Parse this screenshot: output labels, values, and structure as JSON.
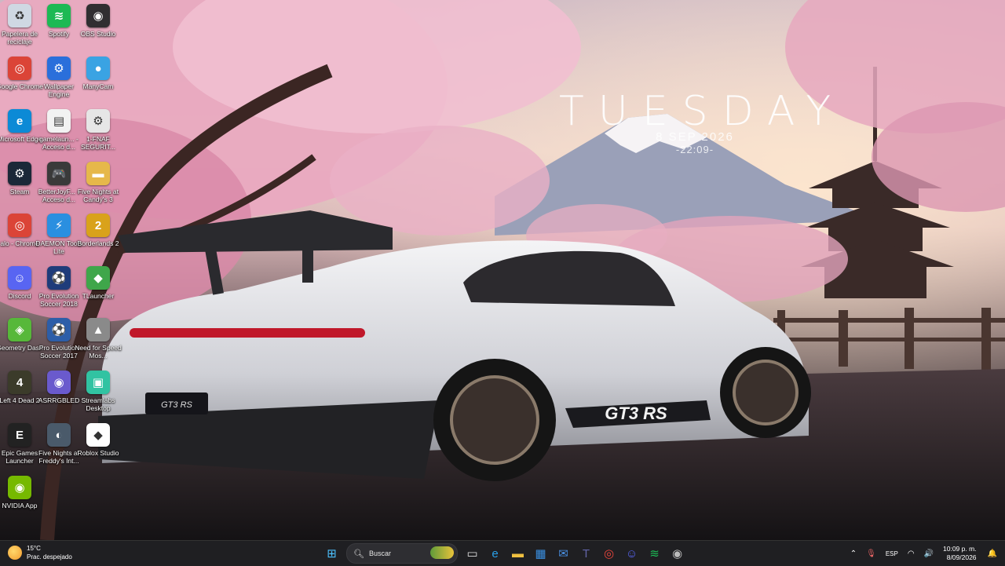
{
  "clock": {
    "day": "TUESDAY",
    "date": "8 SEP 2026",
    "time": "-22:09-"
  },
  "desktop_icons": [
    {
      "label": "Papelera de reciclaje",
      "icon": "recycle-bin-icon",
      "color": "#cfd8e3",
      "glyph": "♻"
    },
    {
      "label": "Spotify",
      "icon": "spotify-icon",
      "color": "#1db954",
      "glyph": "≋"
    },
    {
      "label": "OBS Studio",
      "icon": "obs-icon",
      "color": "#302e31",
      "glyph": "◉"
    },
    {
      "label": "Google Chrome",
      "icon": "chrome-icon",
      "color": "#db4437",
      "glyph": "◎"
    },
    {
      "label": "Wallpaper Engine",
      "icon": "wallpaper-engine-icon",
      "color": "#2a6fdb",
      "glyph": "⚙"
    },
    {
      "label": "ManyCam",
      "icon": "manycam-icon",
      "color": "#3aa3e3",
      "glyph": "●"
    },
    {
      "label": "Microsoft Edge",
      "icon": "edge-icon",
      "color": "#0c8ad6",
      "glyph": "e"
    },
    {
      "label": "gamelaun... - Acceso d...",
      "icon": "shortcut-icon",
      "color": "#f2f2f2",
      "glyph": "▤"
    },
    {
      "label": "1-FNAF SEGURIT...",
      "icon": "settings-file-icon",
      "color": "#e6e6e6",
      "glyph": "⚙"
    },
    {
      "label": "Steam",
      "icon": "steam-icon",
      "color": "#1b2838",
      "glyph": "⚙"
    },
    {
      "label": "BetterJoyF... - Acceso d...",
      "icon": "gamepad-icon",
      "color": "#3a3a3a",
      "glyph": "🎮"
    },
    {
      "label": "Five Nights at Candy's 3",
      "icon": "folder-icon",
      "color": "#e6b84a",
      "glyph": "▬"
    },
    {
      "label": "alo - Chrome",
      "icon": "chrome-icon",
      "color": "#db4437",
      "glyph": "◎"
    },
    {
      "label": "DAEMON Tools Lite",
      "icon": "daemon-tools-icon",
      "color": "#2a8fe0",
      "glyph": "⚡"
    },
    {
      "label": "Borderlands 2",
      "icon": "borderlands-icon",
      "color": "#d9a21b",
      "glyph": "2"
    },
    {
      "label": "Discord",
      "icon": "discord-icon",
      "color": "#5865f2",
      "glyph": "☺"
    },
    {
      "label": "Pro Evolution Soccer 2018",
      "icon": "pes-icon",
      "color": "#1f3c7a",
      "glyph": "⚽"
    },
    {
      "label": "TLauncher",
      "icon": "tlauncher-icon",
      "color": "#3fa64a",
      "glyph": "◆"
    },
    {
      "label": "Geometry Dash",
      "icon": "geometry-dash-icon",
      "color": "#57b83a",
      "glyph": "◈"
    },
    {
      "label": "Pro Evolution Soccer 2017",
      "icon": "pes-icon",
      "color": "#2d5ea8",
      "glyph": "⚽"
    },
    {
      "label": "Need for Speed Mos...",
      "icon": "nfs-icon",
      "color": "#8a8a8a",
      "glyph": "▲"
    },
    {
      "label": "Left 4 Dead 2",
      "icon": "l4d2-icon",
      "color": "#3b3b2a",
      "glyph": "4"
    },
    {
      "label": "ASRRGBLED",
      "icon": "asrrgb-icon",
      "color": "#6a5acd",
      "glyph": "◉"
    },
    {
      "label": "Streamlabs Desktop",
      "icon": "streamlabs-icon",
      "color": "#31c3a2",
      "glyph": "▣"
    },
    {
      "label": "Epic Games Launcher",
      "icon": "epic-games-icon",
      "color": "#222222",
      "glyph": "E"
    },
    {
      "label": "Five Nights at Freddy's Int...",
      "icon": "fnaf-icon",
      "color": "#4a5a6a",
      "glyph": "◐"
    },
    {
      "label": "Roblox Studio",
      "icon": "roblox-studio-icon",
      "color": "#ffffff",
      "glyph": "◆"
    },
    {
      "label": "NVIDIA App",
      "icon": "nvidia-icon",
      "color": "#76b900",
      "glyph": "◉"
    }
  ],
  "taskbar": {
    "weather_temp": "15°C",
    "weather_desc": "Prac. despejado",
    "search_placeholder": "Buscar",
    "apps": [
      {
        "icon": "windows-start-icon",
        "glyph": "⊞",
        "color": "#4cc2ff"
      },
      {
        "icon": "task-view-icon",
        "glyph": "▭",
        "color": "#dddddd"
      },
      {
        "icon": "edge-icon",
        "glyph": "e",
        "color": "#2aa0e8"
      },
      {
        "icon": "file-explorer-icon",
        "glyph": "▬",
        "color": "#f0c040"
      },
      {
        "icon": "store-icon",
        "glyph": "▦",
        "color": "#3a8fe0"
      },
      {
        "icon": "mail-icon",
        "glyph": "✉",
        "color": "#4a90e2"
      },
      {
        "icon": "teams-icon",
        "glyph": "T",
        "color": "#6264a7"
      },
      {
        "icon": "chrome-icon",
        "glyph": "◎",
        "color": "#e8453c"
      },
      {
        "icon": "discord-icon",
        "glyph": "☺",
        "color": "#5865f2"
      },
      {
        "icon": "spotify-icon",
        "glyph": "≋",
        "color": "#1db954"
      },
      {
        "icon": "obs-icon",
        "glyph": "◉",
        "color": "#bbbbbb"
      }
    ],
    "tray_lang": "ESP",
    "clock_time": "10:09 p. m.",
    "clock_date": "8/09/2026"
  }
}
